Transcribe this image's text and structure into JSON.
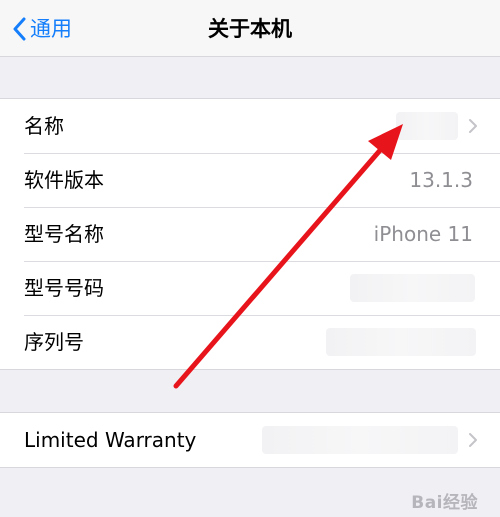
{
  "navbar": {
    "back_label": "通用",
    "title": "关于本机"
  },
  "info_rows": [
    {
      "label": "名称",
      "value": ""
    },
    {
      "label": "软件版本",
      "value": "13.1.3"
    },
    {
      "label": "型号名称",
      "value": "iPhone 11"
    },
    {
      "label": "型号号码",
      "value": ""
    },
    {
      "label": "序列号",
      "value": ""
    }
  ],
  "warranty_row": {
    "label": "Limited Warranty",
    "value": ""
  },
  "annotation_arrow": {
    "color": "#e8141b"
  },
  "watermark": {
    "text": "Bai经验"
  },
  "colors": {
    "accent": "#157efb",
    "background": "#efeff4",
    "secondary_text": "#8e8e93"
  }
}
